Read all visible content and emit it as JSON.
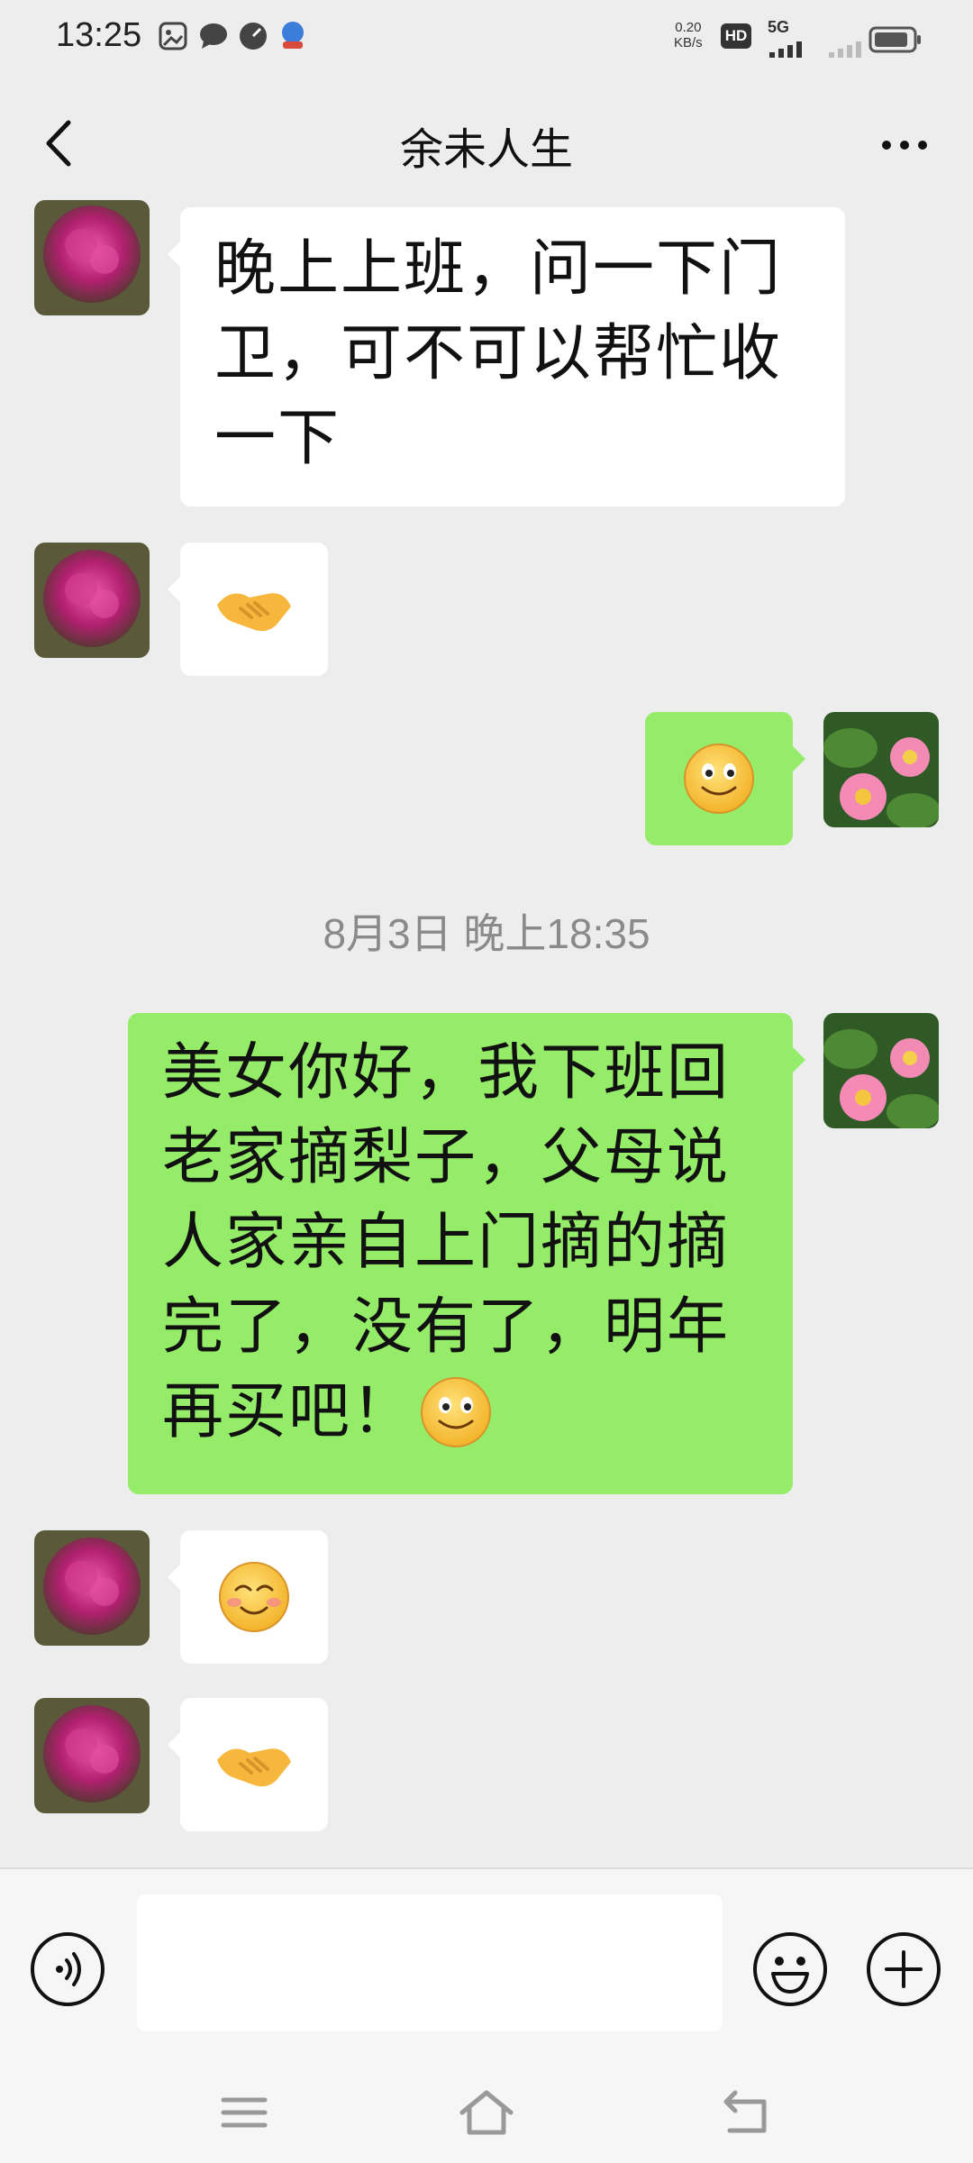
{
  "status_bar": {
    "time": "13:25",
    "net_speed_value": "0.20",
    "net_speed_unit": "KB/s",
    "hd_label": "HD",
    "network_label": "5G",
    "icons": [
      "gallery-icon",
      "chat-icon",
      "speedometer-icon",
      "app-icon",
      "signal-icon",
      "battery-icon"
    ]
  },
  "header": {
    "title": "余未人生",
    "back_icon": "chevron-left-icon",
    "more_icon": "ellipsis-icon"
  },
  "messages": [
    {
      "side": "in",
      "type": "text",
      "lines": [
        "晚上上班，问一下门",
        "卫，可不可以帮忙收",
        "一下"
      ]
    },
    {
      "side": "in",
      "type": "emoji",
      "emoji": "handshake"
    },
    {
      "side": "out",
      "type": "emoji",
      "emoji": "smile"
    },
    {
      "side": "out",
      "type": "text",
      "lines": [
        "美女你好，我下班回",
        "老家摘梨子，父母说",
        "人家亲自上门摘的摘",
        "完了，没有了，明年",
        "再买吧！"
      ],
      "trailing_emoji": "smile"
    },
    {
      "side": "in",
      "type": "emoji",
      "emoji": "blush"
    },
    {
      "side": "in",
      "type": "emoji",
      "emoji": "handshake"
    }
  ],
  "timestamp": "8月3日 晚上18:35",
  "input": {
    "value": "",
    "placeholder": "",
    "voice_icon": "voice-icon",
    "emoji_icon": "emoji-icon",
    "plus_icon": "plus-icon"
  },
  "nav": {
    "icons": [
      "menu-icon",
      "home-icon",
      "back-nav-icon"
    ]
  },
  "colors": {
    "background": "#ededed",
    "outgoing_bubble": "#95ec69",
    "incoming_bubble": "#ffffff",
    "timestamp_text": "#8a8a8a"
  }
}
